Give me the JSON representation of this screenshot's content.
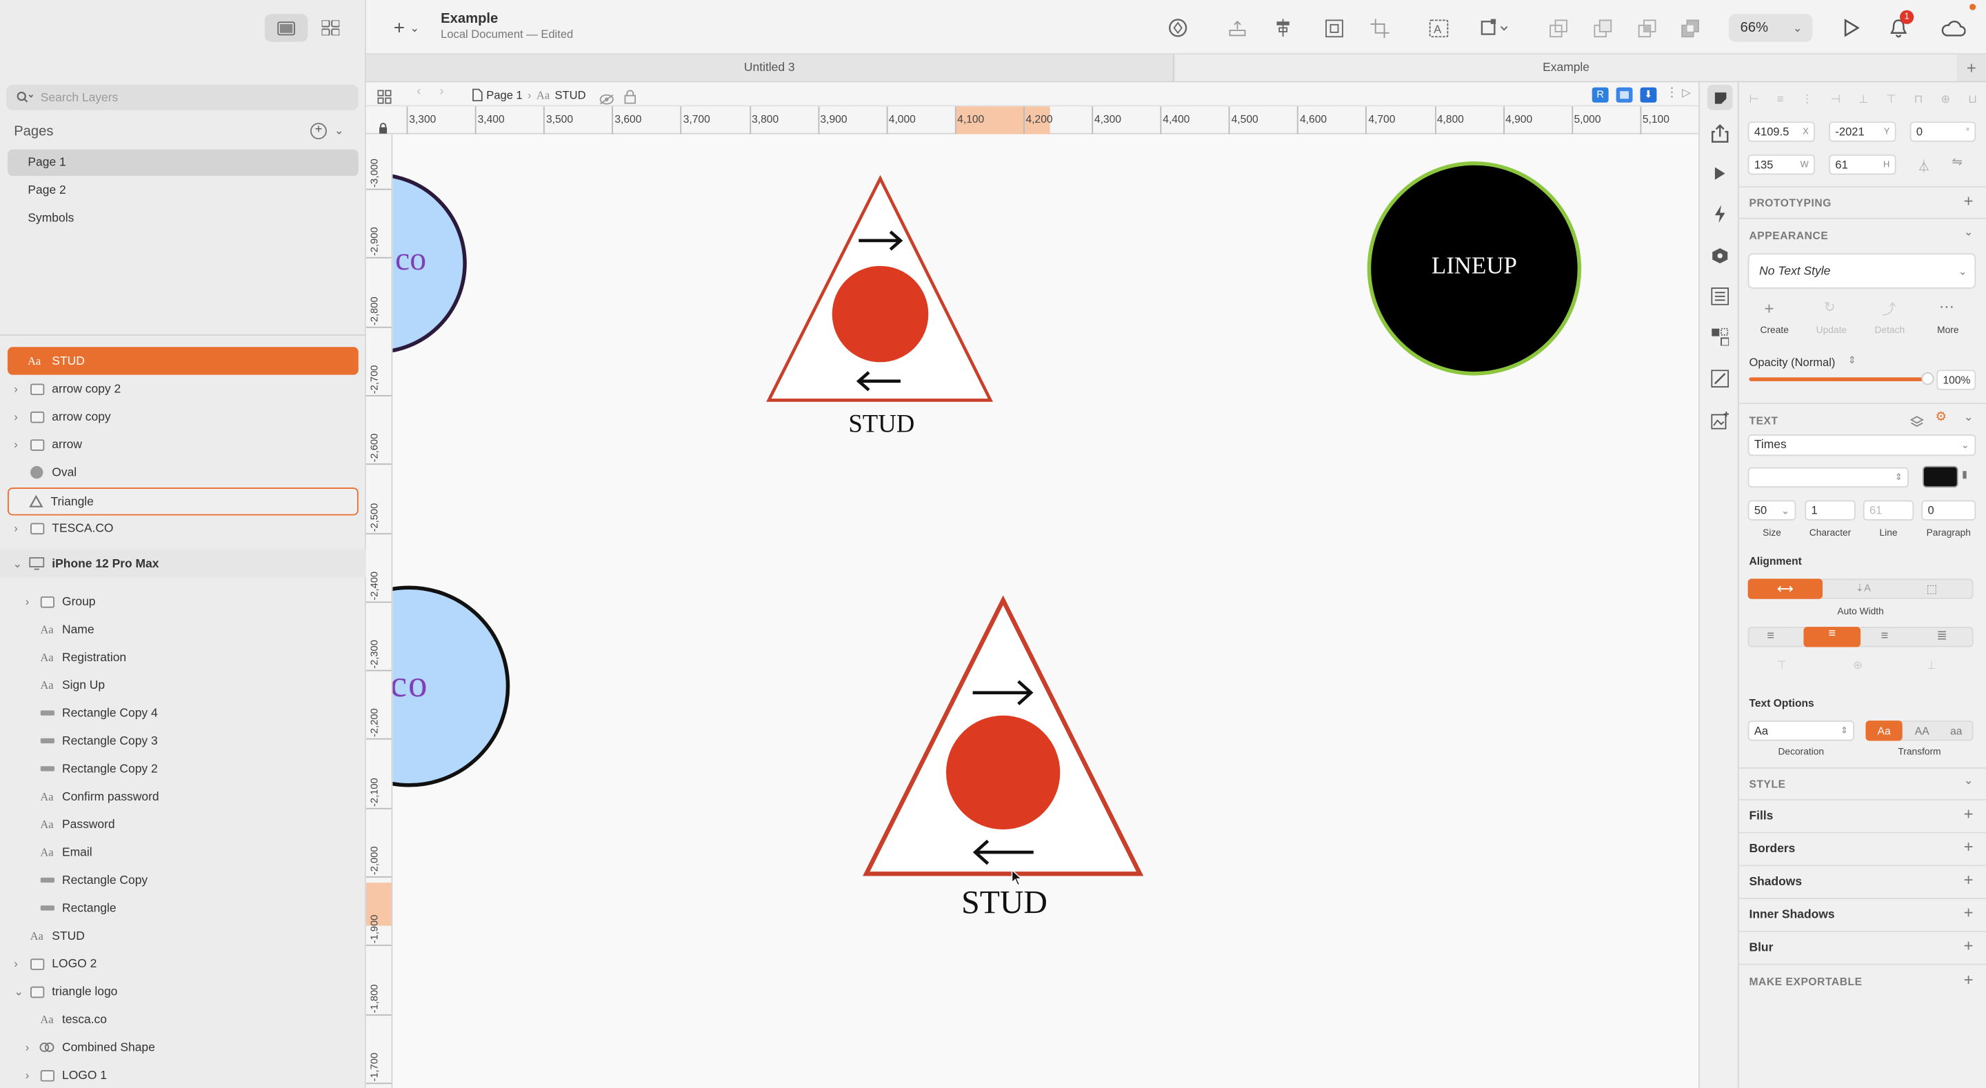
{
  "document": {
    "title": "Example",
    "subtitle": "Local Document — Edited"
  },
  "sidebar": {
    "search_placeholder": "Search Layers",
    "pages_title": "Pages",
    "pages": [
      {
        "label": "Page 1"
      },
      {
        "label": "Page 2"
      },
      {
        "label": "Symbols"
      }
    ],
    "layers": [
      {
        "label": "STUD"
      },
      {
        "label": "arrow copy 2"
      },
      {
        "label": "arrow copy"
      },
      {
        "label": "arrow"
      },
      {
        "label": "Oval"
      },
      {
        "label": "Triangle"
      },
      {
        "label": "TESCA.CO"
      },
      {
        "label": "iPhone 12 Pro Max"
      },
      {
        "label": "Group"
      },
      {
        "label": "Name"
      },
      {
        "label": "Registration"
      },
      {
        "label": "Sign Up"
      },
      {
        "label": "Rectangle Copy 4"
      },
      {
        "label": "Rectangle Copy 3"
      },
      {
        "label": "Rectangle Copy 2"
      },
      {
        "label": "Confirm password"
      },
      {
        "label": "Password"
      },
      {
        "label": "Email"
      },
      {
        "label": "Rectangle Copy"
      },
      {
        "label": "Rectangle"
      },
      {
        "label": "STUD"
      },
      {
        "label": "LOGO 2"
      },
      {
        "label": "triangle logo"
      },
      {
        "label": "tesca.co"
      },
      {
        "label": "Combined Shape"
      },
      {
        "label": "LOGO 1"
      }
    ]
  },
  "toolbar": {
    "zoom": "66%",
    "notification_count": "1"
  },
  "tabs": [
    {
      "label": "Untitled 3"
    },
    {
      "label": "Example"
    }
  ],
  "breadcrumb": {
    "page": "Page 1",
    "layer": "STUD"
  },
  "ruler": {
    "h_ticks": [
      "3,300",
      "3,400",
      "3,500",
      "3,600",
      "3,700",
      "3,800",
      "3,900",
      "4,000",
      "4,100",
      "4,200",
      "4,300",
      "4,400",
      "4,500",
      "4,600",
      "4,700",
      "4,800",
      "4,900",
      "5,000",
      "5,100"
    ],
    "v_ticks": [
      "-3,000",
      "-2,900",
      "-2,800",
      "-2,700",
      "-2,600",
      "-2,500",
      "-2,400",
      "-2,300",
      "-2,200",
      "-2,100",
      "-2,000",
      "-1,900",
      "-1,800",
      "-1,700"
    ]
  },
  "canvas": {
    "left_circle_top_text": "co",
    "left_circle_bottom_text": "co",
    "triangle_top_label": "STUD",
    "triangle_bottom_label": "STUD",
    "black_circle_label": "LINEUP",
    "colors": {
      "red": "#dd3a22",
      "triangle_stroke": "#c8402a",
      "light_blue": "#b4d8fb",
      "green_ring": "#8cc63e",
      "accent": "#e96f2e"
    }
  },
  "inspector": {
    "x": "4109.5",
    "x_unit": "X",
    "y": "-2021",
    "y_unit": "Y",
    "rotation": "0",
    "rotation_unit": "°",
    "w": "135",
    "w_unit": "W",
    "h": "61",
    "h_unit": "H",
    "prototyping": "PROTOTYPING",
    "appearance": "APPEARANCE",
    "text_style": "No Text Style",
    "actions": [
      {
        "label": "Create"
      },
      {
        "label": "Update"
      },
      {
        "label": "Detach"
      },
      {
        "label": "More"
      }
    ],
    "opacity_label": "Opacity (Normal)",
    "opacity_value": "100%",
    "opacity_level": 1.0,
    "text_header": "TEXT",
    "font": "Times",
    "size": "50",
    "character": "1",
    "line": "61",
    "paragraph": "0",
    "size_label": "Size",
    "character_label": "Character",
    "line_label": "Line",
    "paragraph_label": "Paragraph",
    "alignment_label": "Alignment",
    "auto_width_label": "Auto Width",
    "text_options_label": "Text Options",
    "decoration_value": "Aa",
    "decoration_label": "Decoration",
    "transform_label": "Transform",
    "transform_options": [
      "Aa",
      "AA",
      "aa"
    ],
    "style_header": "STYLE",
    "style_items": [
      {
        "label": "Fills"
      },
      {
        "label": "Borders"
      },
      {
        "label": "Shadows"
      },
      {
        "label": "Inner Shadows"
      },
      {
        "label": "Blur"
      }
    ],
    "make_exportable": "MAKE EXPORTABLE"
  }
}
